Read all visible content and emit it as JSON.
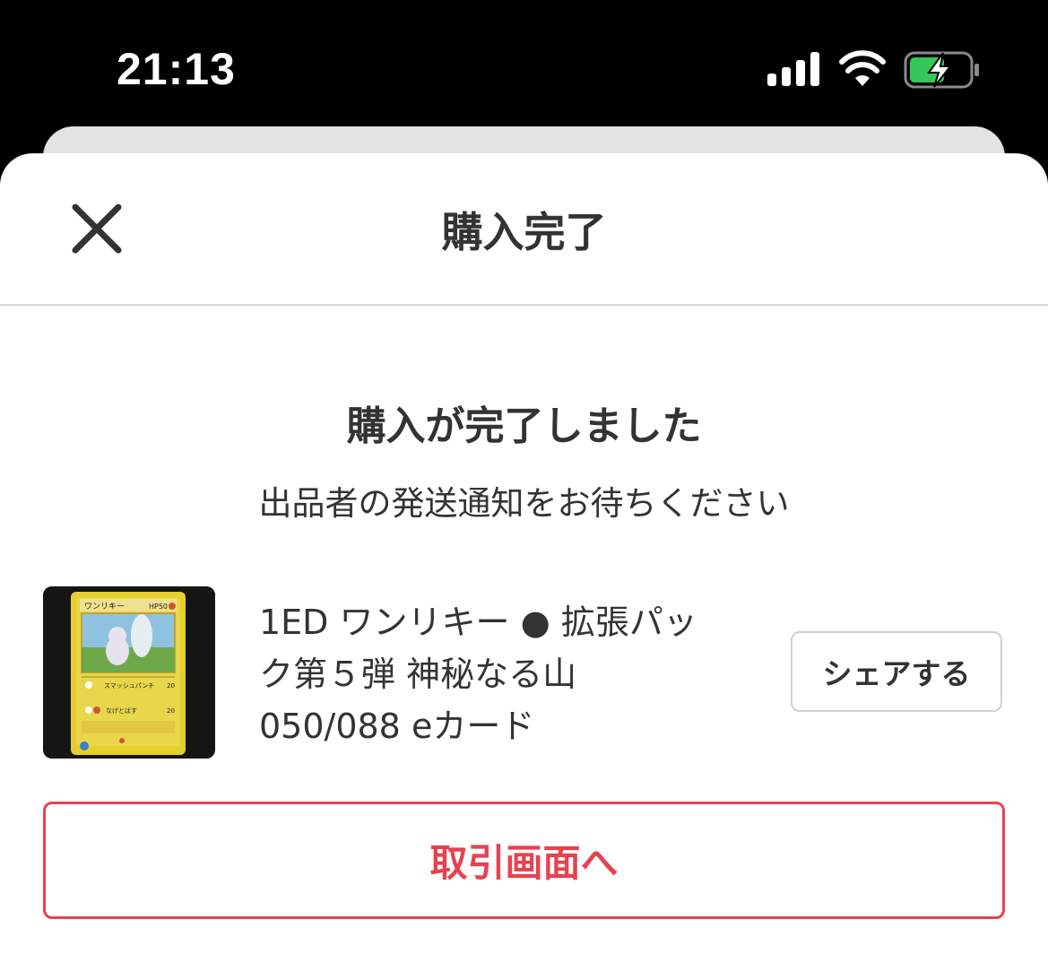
{
  "status_bar": {
    "time": "21:13",
    "signal_icon": "cellular-signal-icon",
    "wifi_icon": "wifi-icon",
    "battery_icon": "battery-charging-icon",
    "battery_color": "#34c759"
  },
  "header": {
    "close_icon": "close-icon",
    "title": "購入完了"
  },
  "confirmation": {
    "title": "購入が完了しました",
    "subtitle": "出品者の発送通知をお待ちください"
  },
  "item": {
    "title_line1": "1ED ワンリキー ● 拡張パッ",
    "title_line2": "ク第５弾 神秘なる山",
    "title_line3": "050/088 eカード",
    "card_name": "ワンリキー",
    "card_hp": "HP50",
    "attack1_name": "スマッシュパンチ",
    "attack1_damage": "20",
    "attack2_name": "なげとばす",
    "attack2_damage": "20",
    "share_label": "シェアする"
  },
  "actions": {
    "trade_label": "取引画面へ",
    "accent_color": "#e8414f"
  }
}
